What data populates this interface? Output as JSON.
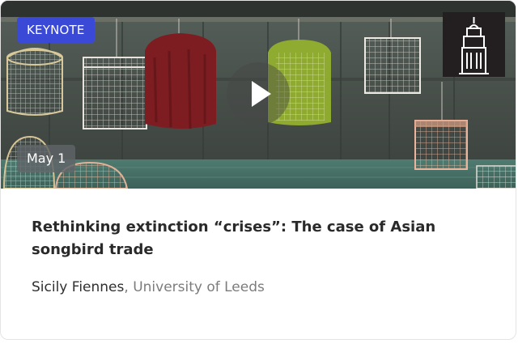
{
  "card": {
    "badge": "KEYNOTE",
    "date": "May 1",
    "title": "Rethinking extinction “crises”: The case of Asian songbird trade",
    "speaker": "Sicily Fiennes",
    "affiliation_separator": ", ",
    "affiliation": "University of Leeds"
  },
  "icons": {
    "play": "play-icon",
    "logo": "university-tower-logo"
  },
  "colors": {
    "badge_bg": "#3b4ad6",
    "date_badge_bg": "#5f6468",
    "title_text": "#2a2a2a",
    "affiliation_text": "#7c7c7c",
    "logo_bg": "#231f20"
  }
}
